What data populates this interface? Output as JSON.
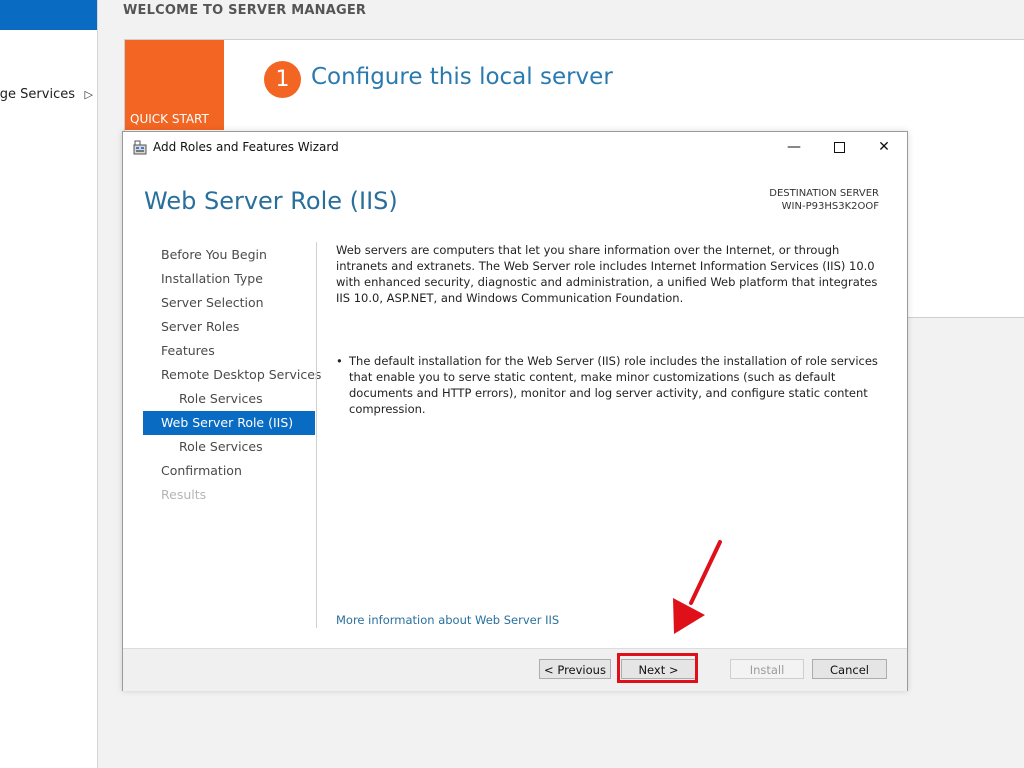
{
  "server_manager": {
    "sidebar_item": "age Services",
    "welcome": "WELCOME TO SERVER MANAGER",
    "quick_start": "QUICK START",
    "step_number": "1",
    "step_text": "Configure this local server"
  },
  "dialog": {
    "title": "Add Roles and Features Wizard",
    "heading": "Web Server Role (IIS)",
    "destination_label": "DESTINATION SERVER",
    "destination_server": "WIN-P93HS3K2OOF",
    "nav": [
      {
        "label": "Before You Begin"
      },
      {
        "label": "Installation Type"
      },
      {
        "label": "Server Selection"
      },
      {
        "label": "Server Roles"
      },
      {
        "label": "Features"
      },
      {
        "label": "Remote Desktop Services"
      },
      {
        "label": "Role Services"
      },
      {
        "label": "Web Server Role (IIS)"
      },
      {
        "label": "Role Services"
      },
      {
        "label": "Confirmation"
      },
      {
        "label": "Results"
      }
    ],
    "description": "Web servers are computers that let you share information over the Internet, or through intranets and extranets. The Web Server role includes Internet Information Services (IIS) 10.0 with enhanced security, diagnostic and administration, a unified Web platform that integrates IIS 10.0, ASP.NET, and Windows Communication Foundation.",
    "bullet": "The default installation for the Web Server (IIS) role includes the installation of role services that enable you to serve static content, make minor customizations (such as default documents and HTTP errors), monitor and log server activity, and configure static content compression.",
    "more_info_link": "More information about Web Server IIS",
    "buttons": {
      "previous": "< Previous",
      "next": "Next >",
      "install": "Install",
      "cancel": "Cancel"
    }
  },
  "colors": {
    "accent_blue": "#0a6bc2",
    "heading_blue": "#2a6f9c",
    "quick_start_orange": "#f26522",
    "highlight_red": "#e0101a"
  },
  "icons": {
    "title": "wizard-icon",
    "minimize": "minimize-icon",
    "maximize": "maximize-icon",
    "close": "close-icon",
    "sidebar_arrow": "chevron-right-icon"
  }
}
